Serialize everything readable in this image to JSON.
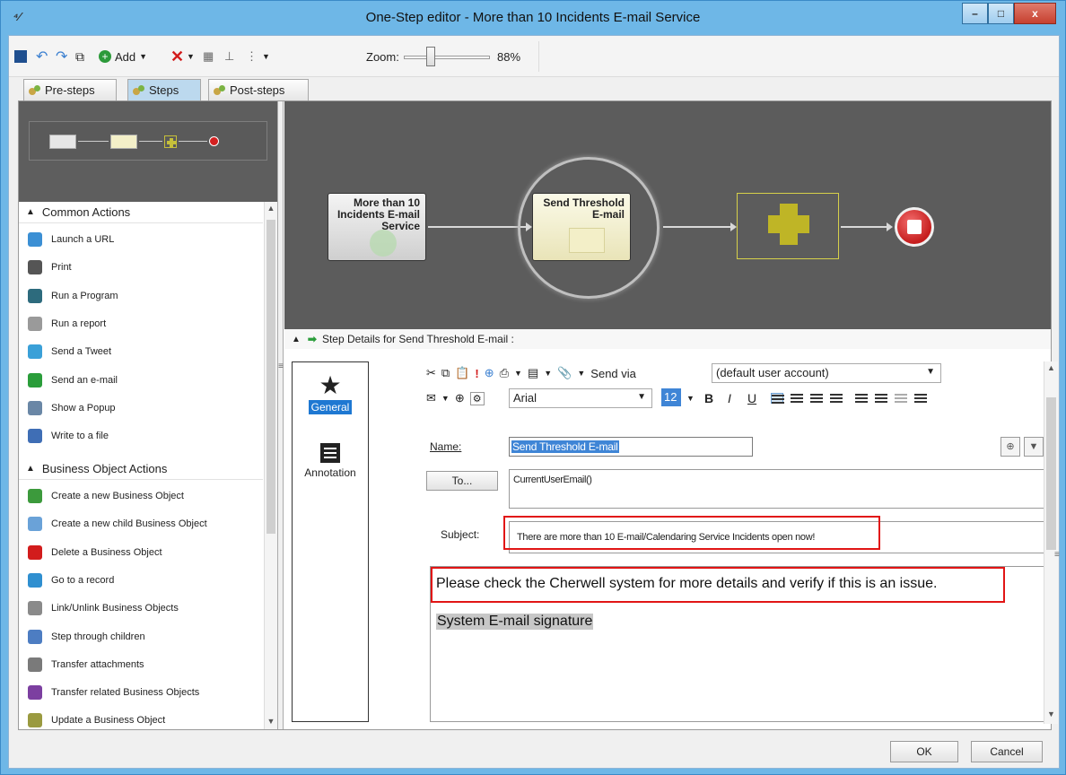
{
  "window": {
    "title": "One-Step editor - More than 10 Incidents E-mail Service",
    "app_icon": "workflow-icon",
    "controls": {
      "minimize": "–",
      "maximize": "□",
      "close": "x"
    }
  },
  "toolbar": {
    "add_label": "Add",
    "zoom_label": "Zoom:",
    "zoom_value": "88%",
    "zoom_level_fraction": 0.3
  },
  "tabs": [
    {
      "label": "Pre-steps",
      "active": false
    },
    {
      "label": "Steps",
      "active": true
    },
    {
      "label": "Post-steps",
      "active": false
    }
  ],
  "left_pane": {
    "common_header": "Common Actions",
    "common_actions": [
      {
        "label": "Launch a URL",
        "icon": "globe-icon",
        "color": "#3b8fd4"
      },
      {
        "label": "Print",
        "icon": "printer-icon",
        "color": "#555555"
      },
      {
        "label": "Run a Program",
        "icon": "program-icon",
        "color": "#2d6b7d"
      },
      {
        "label": "Run a report",
        "icon": "report-icon",
        "color": "#9a9a9a"
      },
      {
        "label": "Send a Tweet",
        "icon": "tweet-icon",
        "color": "#3aa0d8"
      },
      {
        "label": "Send an e-mail",
        "icon": "send-email-icon",
        "color": "#2a9d3a"
      },
      {
        "label": "Show a Popup",
        "icon": "popup-icon",
        "color": "#6a87a6"
      },
      {
        "label": "Write to a file",
        "icon": "save-file-icon",
        "color": "#3f6eb5"
      }
    ],
    "bo_header": "Business Object Actions",
    "bo_actions": [
      {
        "label": "Create a new Business Object",
        "icon": "add-object-icon",
        "color": "#3c9a3c"
      },
      {
        "label": "Create a new child Business Object",
        "icon": "child-object-icon",
        "color": "#6aa2d8"
      },
      {
        "label": "Delete a Business Object",
        "icon": "delete-icon",
        "color": "#d21c1c"
      },
      {
        "label": "Go to a record",
        "icon": "goto-icon",
        "color": "#2f8fd0"
      },
      {
        "label": "Link/Unlink Business Objects",
        "icon": "link-icon",
        "color": "#8a8a8a"
      },
      {
        "label": "Step through children",
        "icon": "step-children-icon",
        "color": "#4d7dc2"
      },
      {
        "label": "Transfer attachments",
        "icon": "attachment-icon",
        "color": "#7a7a7a"
      },
      {
        "label": "Transfer related Business Objects",
        "icon": "transfer-related-icon",
        "color": "#7c3fa0"
      },
      {
        "label": "Update a Business Object",
        "icon": "update-icon",
        "color": "#9a9a40"
      }
    ]
  },
  "canvas": {
    "node_start": "More than 10 Incidents E-mail Service",
    "node_email": "Send Threshold E-mail"
  },
  "details": {
    "header": "Step Details for Send Threshold E-mail :",
    "side_tabs": {
      "general": "General",
      "annotation": "Annotation"
    },
    "send_via_label": "Send via",
    "send_via_value": "(default user account)",
    "font_name": "Arial",
    "font_size": "12",
    "name_label": "Name:",
    "name_value": "Send Threshold E-mail",
    "to_button": "To...",
    "to_value": "CurrentUserEmail()",
    "subject_label": "Subject:",
    "subject_value": "There are more than 10 E-mail/Calendaring Service Incidents open now!",
    "body_line1": "Please check the Cherwell system for more details and verify if this is an issue.",
    "body_line2": "System E-mail signature"
  },
  "footer": {
    "ok": "OK",
    "cancel": "Cancel"
  }
}
